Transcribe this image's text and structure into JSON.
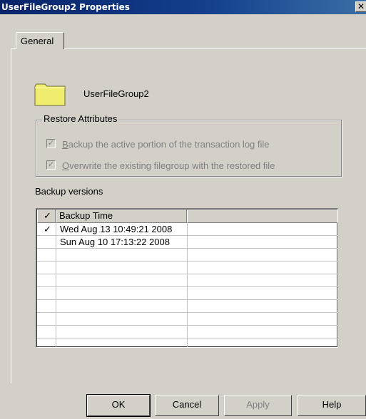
{
  "window": {
    "title": "UserFileGroup2 Properties",
    "close_glyph": "✕"
  },
  "tabs": [
    {
      "label": "General"
    }
  ],
  "general": {
    "folder_icon": "folder-icon",
    "folder_name": "UserFileGroup2",
    "restore_attributes": {
      "title": "Restore Attributes",
      "options": [
        {
          "label": "Backup the active portion of the transaction log file",
          "mnemonic": "B",
          "rest": "ackup the active portion of the transaction log file",
          "checked": true,
          "enabled": false
        },
        {
          "label": "Overwrite the existing filegroup with the restored file",
          "mnemonic": "O",
          "rest": "verwrite the existing filegroup with the restored file",
          "checked": true,
          "enabled": false
        }
      ]
    },
    "backup_versions": {
      "label": "Backup versions",
      "columns": [
        "✓",
        "Backup Time",
        ""
      ],
      "rows": [
        {
          "checked": "✓",
          "time": "Wed Aug 13 10:49:21 2008"
        },
        {
          "checked": "",
          "time": "Sun Aug 10 17:13:22 2008"
        }
      ]
    }
  },
  "buttons": {
    "ok": "OK",
    "cancel": "Cancel",
    "apply": "Apply",
    "help": "Help"
  },
  "colors": {
    "title_bar": "#0a246a",
    "dialog": "#d4d0c8",
    "folder": "#f0ec6e"
  }
}
